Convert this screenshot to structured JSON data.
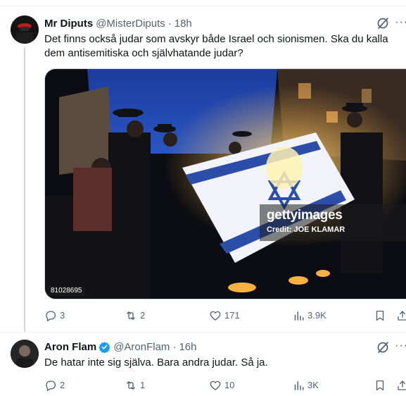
{
  "tweets": [
    {
      "author": {
        "name": "Mr Diputs",
        "handle": "@MisterDiputs",
        "time": "18h",
        "verified": false
      },
      "text": "Det finns också judar som avskyr både Israel och sionismen. Ska du kalla dem antisemitiska och självhatande judar?",
      "media": {
        "watermark_brand": "gettyimages",
        "watermark_credit": "Credit: JOE KLAMAR",
        "image_id": "81028695"
      },
      "stats": {
        "replies": "3",
        "retweets": "2",
        "likes": "171",
        "views": "3.9K"
      }
    },
    {
      "author": {
        "name": "Aron Flam",
        "handle": "@AronFlam",
        "time": "16h",
        "verified": true
      },
      "text": "De hatar inte sig själva. Bara andra judar. Så ja.",
      "stats": {
        "replies": "2",
        "retweets": "1",
        "likes": "10",
        "views": "3K"
      }
    }
  ],
  "colors": {
    "text": "#0f1419",
    "secondary": "#536471",
    "verified": "#1d9bf0",
    "divider": "#eff3f4"
  },
  "icons": [
    "grok-icon",
    "more-icon",
    "reply-icon",
    "retweet-icon",
    "like-icon",
    "views-icon",
    "bookmark-icon",
    "share-icon",
    "verified-icon"
  ]
}
